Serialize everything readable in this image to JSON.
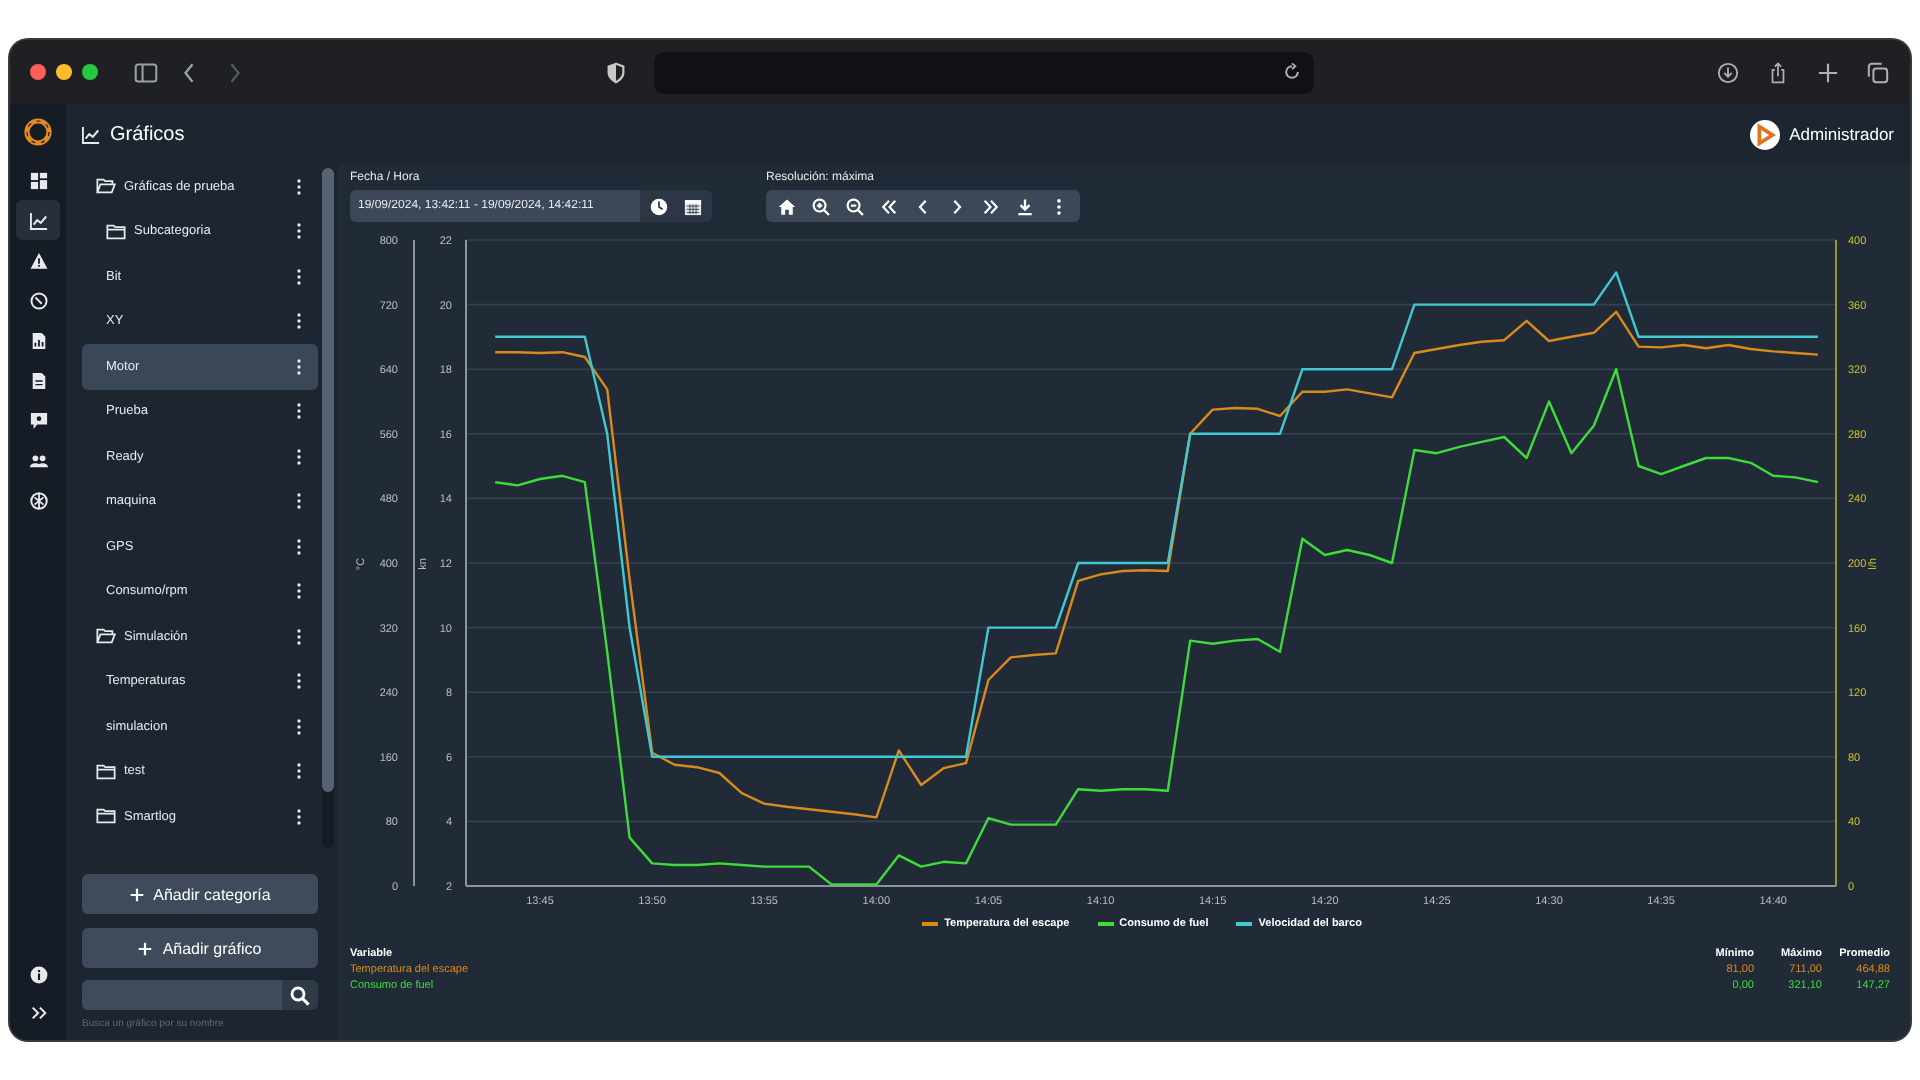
{
  "header": {
    "title": "Gráficos",
    "user": "Administrador"
  },
  "nav_rail": [
    {
      "selected": false
    },
    {
      "selected": true
    },
    {
      "selected": false
    },
    {
      "selected": false
    },
    {
      "selected": false
    },
    {
      "selected": false
    },
    {
      "selected": false
    },
    {
      "selected": false
    },
    {
      "selected": false
    }
  ],
  "sidebar": {
    "items": [
      {
        "kind": "folder",
        "label": "Gráficas de prueba",
        "expanded": true,
        "selected": false,
        "children": [
          {
            "kind": "folder",
            "label": "Subcategoria",
            "expanded": false,
            "selected": false
          },
          {
            "kind": "chart",
            "label": "Bit",
            "selected": false
          },
          {
            "kind": "chart",
            "label": "XY",
            "selected": false
          },
          {
            "kind": "chart",
            "label": "Motor",
            "selected": true
          },
          {
            "kind": "chart",
            "label": "Prueba",
            "selected": false
          },
          {
            "kind": "chart",
            "label": "Ready",
            "selected": false
          },
          {
            "kind": "chart",
            "label": "maquina",
            "selected": false
          },
          {
            "kind": "chart",
            "label": "GPS",
            "selected": false
          },
          {
            "kind": "chart",
            "label": "Consumo/rpm",
            "selected": false
          }
        ]
      },
      {
        "kind": "folder",
        "label": "Simulación",
        "expanded": true,
        "selected": false,
        "children": [
          {
            "kind": "chart",
            "label": "Temperaturas",
            "selected": false
          },
          {
            "kind": "chart",
            "label": "simulacion",
            "selected": false
          }
        ]
      },
      {
        "kind": "folder",
        "label": "test",
        "expanded": false,
        "selected": false
      },
      {
        "kind": "folder",
        "label": "Smartlog",
        "expanded": false,
        "selected": false
      }
    ],
    "buttons": [
      "Añadir categoría",
      "Añadir gráfico"
    ],
    "search": {
      "helper": "Busca un gráfico por su nombre"
    }
  },
  "chart_panel": {
    "date_label": "Fecha / Hora",
    "date_range": "19/09/2024, 13:42:11 - 19/09/2024, 14:42:11",
    "resolution_label": "Resolución: máxima",
    "chart_data": {
      "type": "line",
      "categories": [
        null,
        null,
        "13:45",
        null,
        null,
        null,
        null,
        "13:50",
        null,
        null,
        null,
        null,
        "13:55",
        null,
        null,
        null,
        null,
        "14:00",
        null,
        null,
        null,
        null,
        "14:05",
        null,
        null,
        null,
        null,
        "14:10",
        null,
        null,
        null,
        null,
        "14:15",
        null,
        null,
        null,
        null,
        "14:20",
        null,
        null,
        null,
        null,
        "14:25",
        null,
        null,
        null,
        null,
        "14:30",
        null,
        null,
        null,
        null,
        "14:35",
        null,
        null,
        null,
        null,
        "14:40",
        null,
        null
      ],
      "ylabel": "l/h",
      "ylim": [
        0,
        400
      ],
      "yticks": [
        0,
        40,
        80,
        120,
        160,
        200,
        240,
        280,
        320,
        360,
        400
      ],
      "y2label": "kn",
      "y2lim": [
        2,
        22
      ],
      "y2ticks": [
        2,
        4,
        6,
        8,
        10,
        12,
        14,
        16,
        18,
        20,
        22
      ],
      "y3label": "°C",
      "y3lim": [
        0,
        800
      ],
      "y3ticks": [
        0,
        80,
        160,
        240,
        320,
        400,
        480,
        560,
        640,
        720,
        800
      ],
      "grid": true,
      "series": [
        {
          "name": "Temperatura del escape",
          "color": "#d98a1c",
          "axis": "y3",
          "values": [
            661,
            661,
            660,
            661,
            655,
            615,
            380,
            165,
            150,
            147,
            140,
            115,
            102,
            98,
            95,
            92,
            89,
            85,
            168,
            125,
            146,
            152,
            255,
            283,
            286,
            288,
            378,
            386,
            390,
            391,
            390,
            560,
            590,
            592,
            591,
            582,
            612,
            612,
            615,
            610,
            605,
            660,
            665,
            670,
            674,
            676,
            700,
            675,
            680,
            685,
            711,
            668,
            667,
            670,
            666,
            670,
            665,
            662,
            660,
            658
          ]
        },
        {
          "name": "Consumo de fuel",
          "color": "#3ddc3a",
          "values": [
            250,
            248,
            252,
            254,
            250,
            145,
            30,
            14,
            13,
            13,
            14,
            13,
            12,
            12,
            12,
            1,
            1,
            1,
            19,
            12,
            15,
            14,
            42,
            38,
            38,
            38,
            60,
            59,
            60,
            60,
            59,
            152,
            150,
            152,
            153,
            145,
            215,
            205,
            208,
            205,
            200,
            270,
            268,
            272,
            275,
            278,
            265,
            300,
            268,
            285,
            320,
            260,
            255,
            260,
            265,
            265,
            262,
            254,
            253,
            250
          ]
        },
        {
          "name": "Velocidad del barco",
          "color": "#40c9d1",
          "axis": "y2",
          "values": [
            19,
            19,
            19,
            19,
            19,
            16,
            10,
            6,
            6,
            6,
            6,
            6,
            6,
            6,
            6,
            6,
            6,
            6,
            6,
            6,
            6,
            6,
            10,
            10,
            10,
            10,
            12,
            12,
            12,
            12,
            12,
            16,
            16,
            16,
            16,
            16,
            18,
            18,
            18,
            18,
            18,
            20,
            20,
            20,
            20,
            20,
            20,
            20,
            20,
            20,
            21,
            19,
            19,
            19,
            19,
            19,
            19,
            19,
            19,
            19
          ]
        }
      ]
    },
    "stats": {
      "columns": [
        "Variable",
        "Mínimo",
        "Máximo",
        "Promedio"
      ],
      "rows": [
        {
          "variable": "Temperatura del escape",
          "min": "81,00",
          "max": "711,00",
          "avg": "464,88",
          "color": "#d98a1c"
        },
        {
          "variable": "Consumo de fuel",
          "min": "0,00",
          "max": "321,10",
          "avg": "147,27",
          "color": "#3ddc3a"
        }
      ]
    }
  }
}
